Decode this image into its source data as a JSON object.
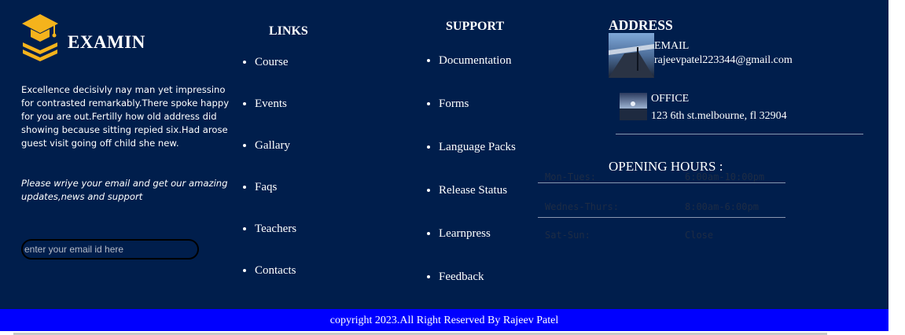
{
  "brand": {
    "name": "EXAMIN"
  },
  "about": {
    "text": "Excellence decisivly nay man yet impressino for contrasted remarkably.There spoke happy for you are out.Fertilly how old address did showing because sitting repied six.Had arose guest visit going off child she new."
  },
  "newsletter": {
    "text": "Please wriye your email and get our amazing updates,news and support",
    "placeholder": "enter your email id here"
  },
  "links": {
    "title": "LINKS",
    "items": [
      "Course",
      "Events",
      "Gallary",
      "Faqs",
      "Teachers",
      "Contacts"
    ]
  },
  "support": {
    "title": "SUPPORT",
    "items": [
      "Documentation",
      "Forms",
      "Language Packs",
      "Release Status",
      "Learnpress",
      "Feedback"
    ]
  },
  "address": {
    "title": "ADDRESS",
    "email_label": "EMAIL",
    "email": "rajeevpatel223344@gmail.com",
    "office_label": "OFFICE",
    "office": "123 6th st.melbourne, fl 32904"
  },
  "hours": {
    "title": "OPENING HOURS :",
    "rows": [
      {
        "day": "Mon-Tues:",
        "time": "6:00am-10:00pm"
      },
      {
        "day": "Wednes-Thurs:",
        "time": "8:00am-6:00pm"
      },
      {
        "day": "Sat-Sun:",
        "time": "Close"
      }
    ]
  },
  "copyright": "copyright 2023.All Right Reserved By Rajeev Patel",
  "colors": {
    "footer_bg": "#001e4c",
    "copyright_bg": "#0000ff",
    "logo": "#f5b31c"
  }
}
